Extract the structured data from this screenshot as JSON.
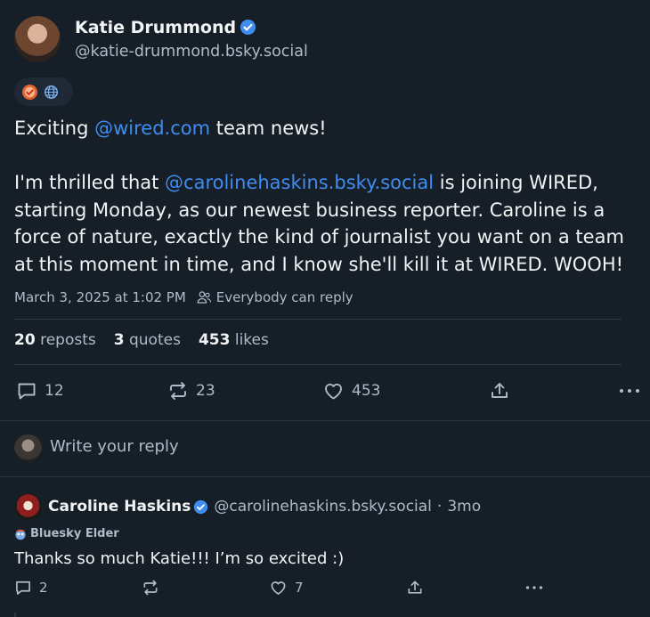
{
  "post": {
    "author_name": "Katie Drummond",
    "author_handle": "@katie-drummond.bsky.social",
    "text_line1_prefix": "Exciting ",
    "text_line1_mention": "@wired.com",
    "text_line1_suffix": " team news!",
    "text_para2_prefix": "I'm thrilled that ",
    "text_para2_mention": "@carolinehaskins.bsky.social",
    "text_para2_rest": " is joining WIRED, starting Monday, as our newest business reporter. Caroline is a force of nature, exactly the kind of journalist you want on a team at this moment in time, and I know she'll kill it at WIRED. WOOH!",
    "timestamp": "March 3, 2025 at 1:02 PM",
    "reply_setting": "Everybody can reply",
    "stats": {
      "reposts_count": "20",
      "reposts_label": "reposts",
      "quotes_count": "3",
      "quotes_label": "quotes",
      "likes_count": "453",
      "likes_label": "likes"
    },
    "actions": {
      "replies": "12",
      "reposts": "23",
      "likes": "453"
    }
  },
  "reply_box": {
    "placeholder": "Write your reply"
  },
  "reply": {
    "author_name": "Caroline Haskins",
    "author_handle": "@carolinehaskins.bsky.social",
    "separator": "·",
    "age": "3mo",
    "badge_label": "Bluesky Elder",
    "text": "Thanks so much Katie!!! I’m so excited :)",
    "actions": {
      "replies": "2",
      "likes": "7"
    }
  },
  "icons": {
    "verified": "verified-check-icon",
    "badge_a": "orange-check-badge-icon",
    "badge_b": "globe-icon",
    "reply": "speech-bubble-icon",
    "repost": "repost-arrows-icon",
    "like": "heart-icon",
    "share": "share-upload-icon",
    "more": "ellipsis-icon",
    "people": "people-icon"
  },
  "colors": {
    "background": "#161e27",
    "accent": "#3f8df0",
    "muted": "#aebbc9",
    "divider": "#2b3745"
  }
}
